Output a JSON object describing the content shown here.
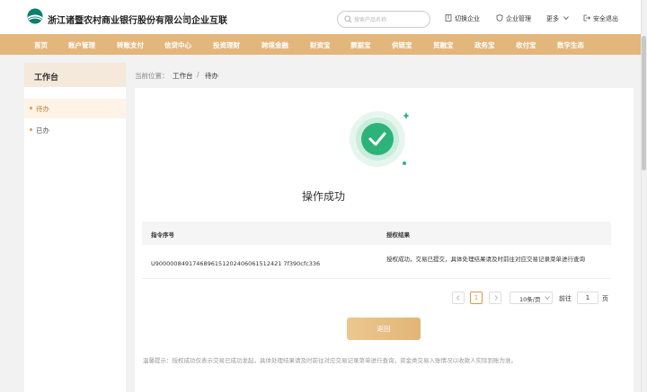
{
  "header": {
    "bank_name": "浙江诸暨农村商业银行股份有限公司",
    "portal_name": "企业互联",
    "search_placeholder": "搜索产品名称",
    "switch_company": "切换企业",
    "company_manage": "企业管理",
    "more": "更多",
    "logout": "安全退出"
  },
  "nav": [
    "首页",
    "账户管理",
    "转账支付",
    "信贷中心",
    "投资理财",
    "跨境金融",
    "财资宝",
    "票据宝",
    "供链宝",
    "贸融宝",
    "政务宝",
    "收付宝",
    "数字生态"
  ],
  "sidebar": {
    "title": "工作台",
    "items": [
      {
        "label": "待办",
        "active": true
      },
      {
        "label": "已办",
        "active": false
      }
    ]
  },
  "breadcrumb": {
    "prefix": "当前位置：",
    "level1": "工作台",
    "sep": "/",
    "level2": "待办"
  },
  "result": {
    "title": "操作成功"
  },
  "table": {
    "headers": [
      "指令序号",
      "授权结果"
    ],
    "rows": [
      {
        "id": "U9000008491746896151202406061512421 7f390cfc336",
        "result": "授权成功，交易已提交，具体处理结果请及时前往对应交易记录菜单进行查询"
      }
    ]
  },
  "pagination": {
    "current": "1",
    "page_size": "10条/页",
    "goto_label": "前往",
    "goto_value": "1",
    "page_unit": "页"
  },
  "back_button": "返回",
  "tip": "温馨提示：授权成功仅表示交易已成功发起，具体处理结果请及时前往对应交易记录菜单进行查询，资金类交易入账情况以收款人实际到账为准。",
  "colors": {
    "nav_bg": "#e3b67c",
    "success_green": "#2db37a",
    "accent": "#d89a4a"
  }
}
